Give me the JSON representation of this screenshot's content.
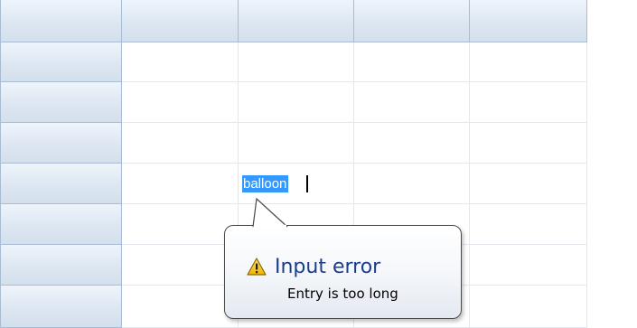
{
  "grid": {
    "columns": [
      "",
      "",
      "",
      ""
    ],
    "rows": [
      "",
      "",
      "",
      "",
      "",
      "",
      ""
    ],
    "active_cell": {
      "text": "balloon",
      "selected": true
    }
  },
  "balloon": {
    "icon": "warning-icon",
    "title": "Input error",
    "message": "Entry is too long",
    "colors": {
      "title": "#1a3e8c",
      "warning_fill": "#f5c400"
    }
  },
  "colors": {
    "header_gradient_top": "#eef4fb",
    "header_gradient_bottom": "#d3dfec",
    "header_border": "#a9bcd3",
    "gridline": "#e3e8ee",
    "selection": "#3399ff"
  }
}
